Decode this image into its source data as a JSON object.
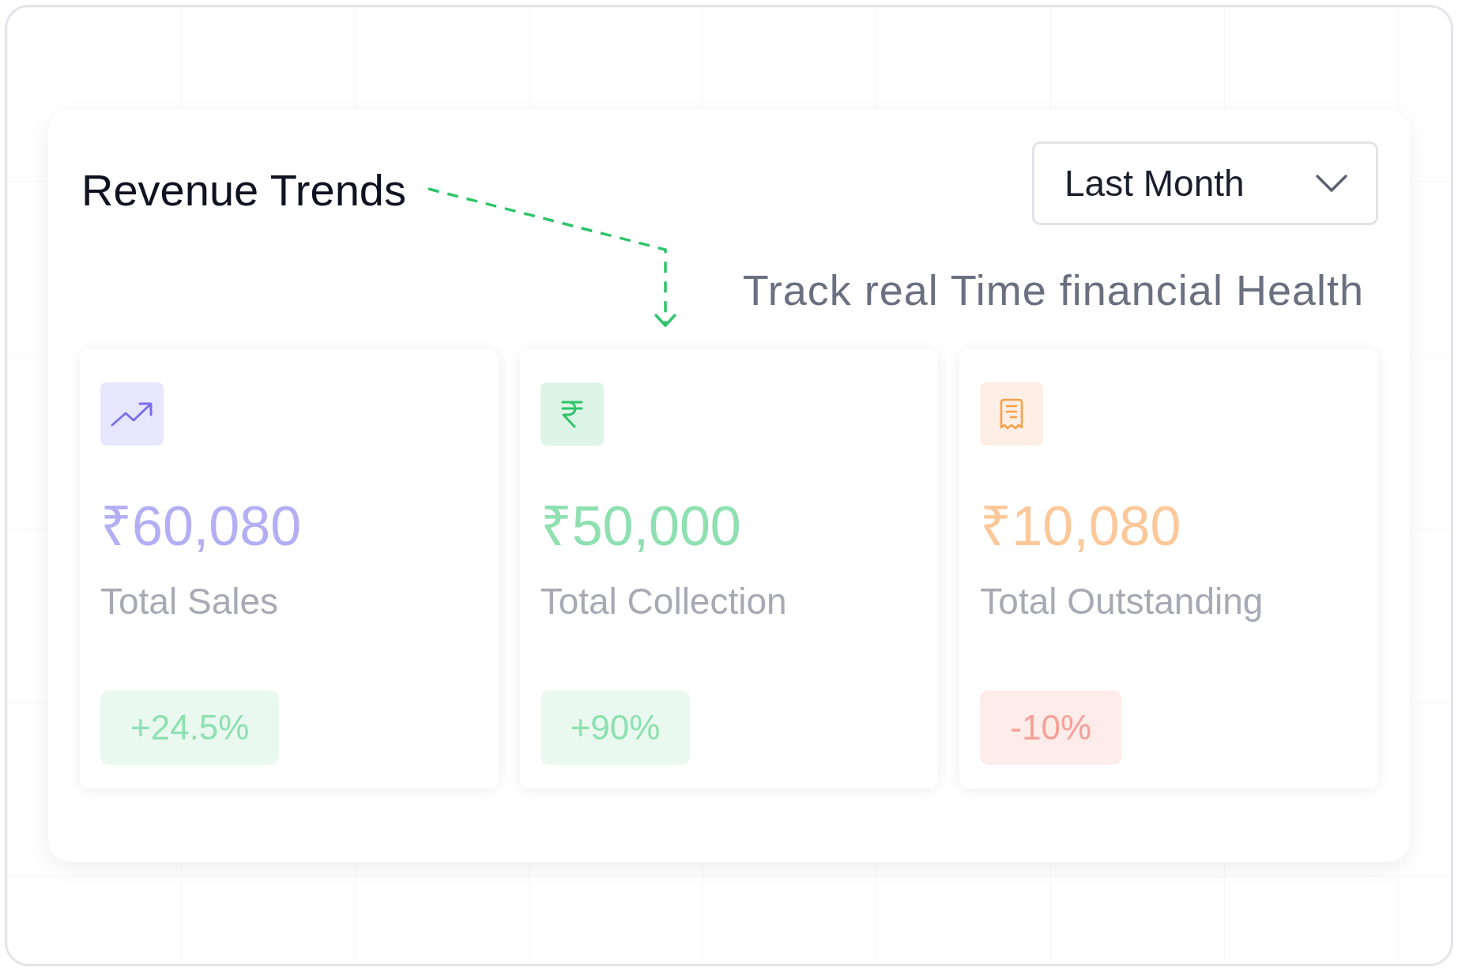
{
  "header": {
    "title": "Revenue Trends",
    "period": "Last Month"
  },
  "annotation": "Track real Time financial Health",
  "cards": [
    {
      "kind": "sales",
      "color": "#b4aef5",
      "value": "₹60,080",
      "label": "Total Sales",
      "change": "+24.5%",
      "negative": false
    },
    {
      "kind": "collection",
      "color": "#8ee0b0",
      "value": "₹50,000",
      "label": "Total Collection",
      "change": "+90%",
      "negative": false
    },
    {
      "kind": "outstanding",
      "color": "#fcc89a",
      "value": "₹10,080",
      "label": "Total Outstanding",
      "change": "-10%",
      "negative": true
    }
  ]
}
